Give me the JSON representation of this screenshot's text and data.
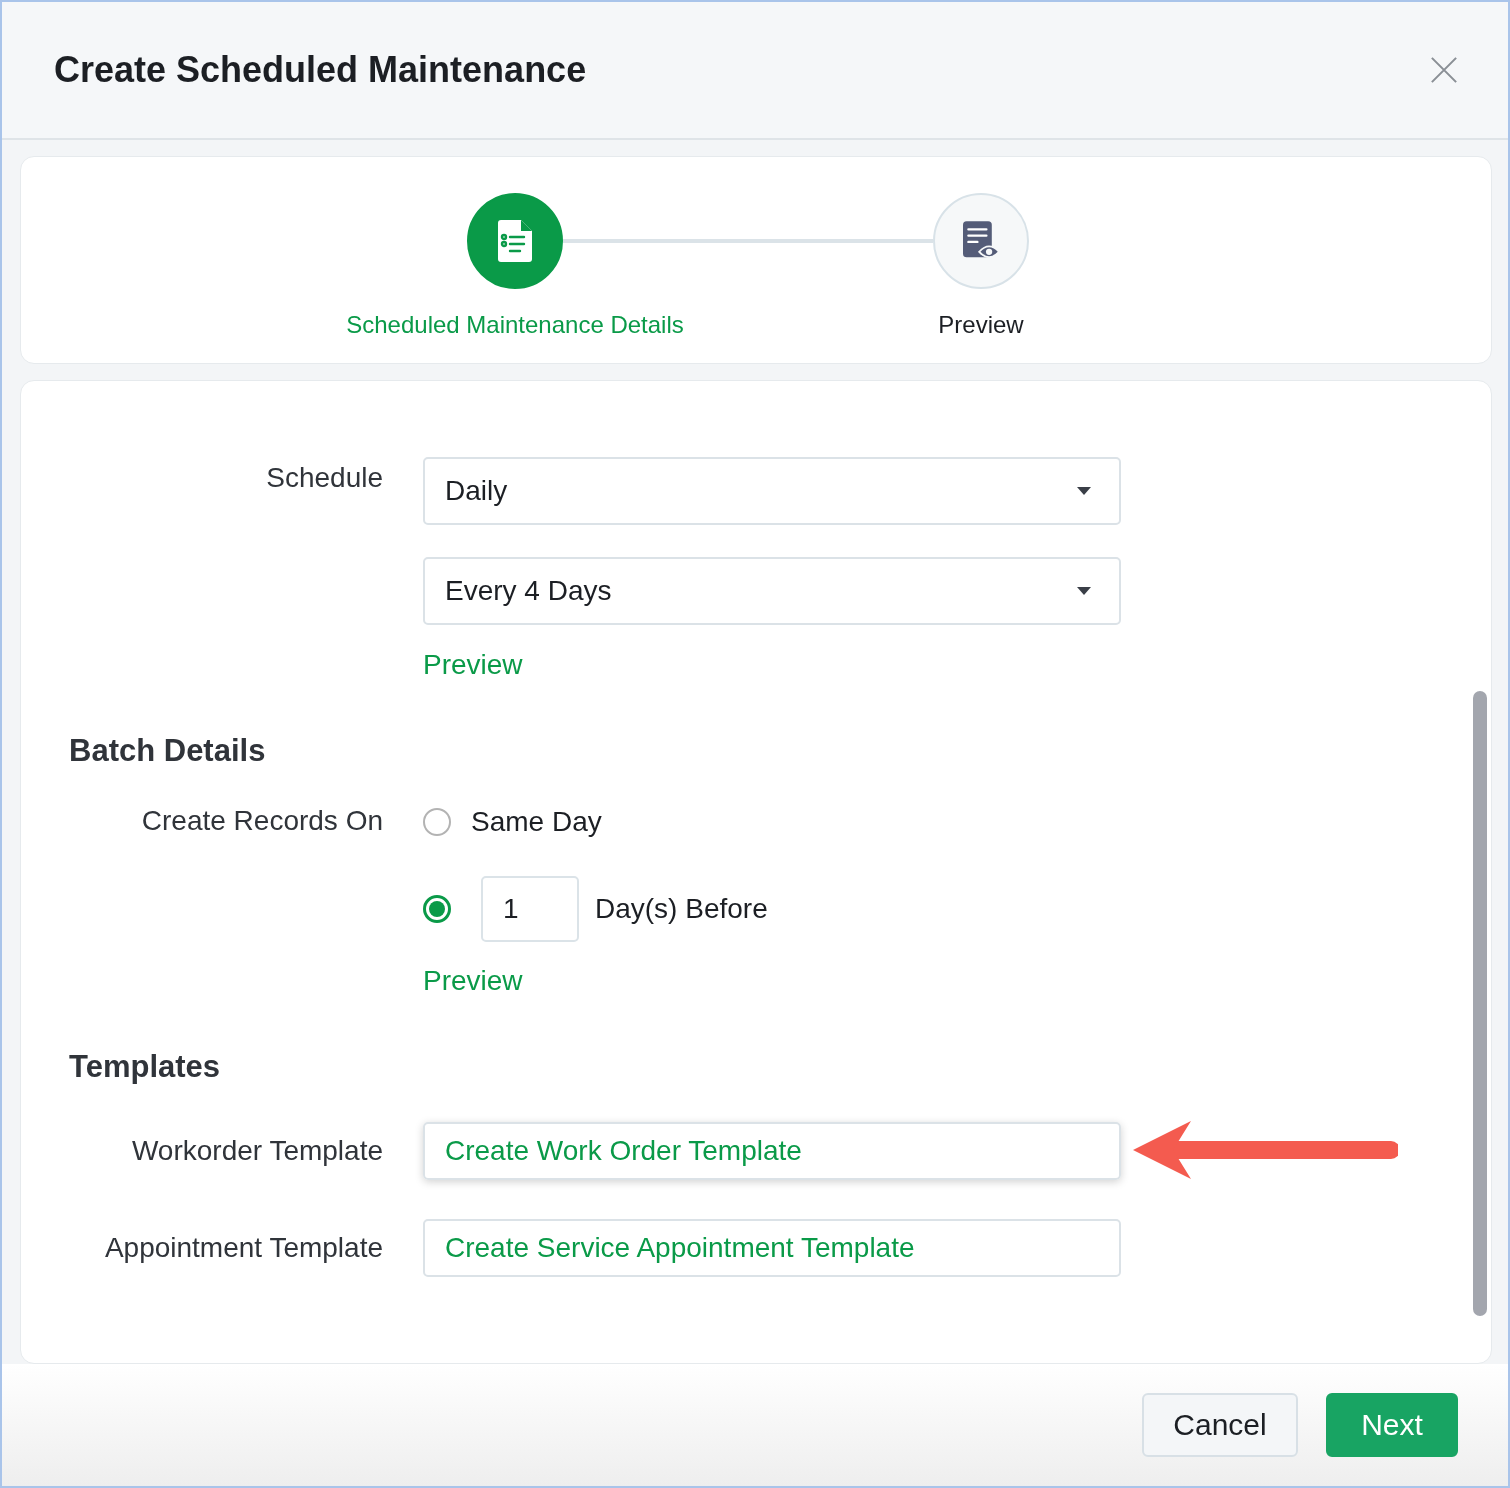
{
  "dialog": {
    "title": "Create Scheduled Maintenance"
  },
  "steps": [
    {
      "label": "Scheduled Maintenance Details",
      "kind": "details",
      "selected": true
    },
    {
      "label": "Preview",
      "kind": "preview",
      "selected": false
    }
  ],
  "schedule": {
    "label": "Schedule",
    "selects": [
      {
        "value": "Daily"
      },
      {
        "value": "Every 4 Days"
      }
    ],
    "preview_link": "Preview"
  },
  "batch": {
    "heading": "Batch Details",
    "label": "Create Records On",
    "options": [
      {
        "kind": "plain",
        "label": "Same Day",
        "selected": false
      },
      {
        "kind": "days",
        "value": "1",
        "label": "Day(s) Before",
        "selected": true
      }
    ],
    "preview_link": "Preview"
  },
  "templates": {
    "heading": "Templates",
    "rows": [
      {
        "label": "Workorder Template",
        "link": "Create Work Order Template",
        "highlighted": true
      },
      {
        "label": "Appointment Template",
        "link": "Create Service Appointment Template",
        "highlighted": false
      }
    ]
  },
  "buttons": [
    {
      "label": "Cancel",
      "kind": "secondary"
    },
    {
      "label": "Next",
      "kind": "primary"
    }
  ]
}
